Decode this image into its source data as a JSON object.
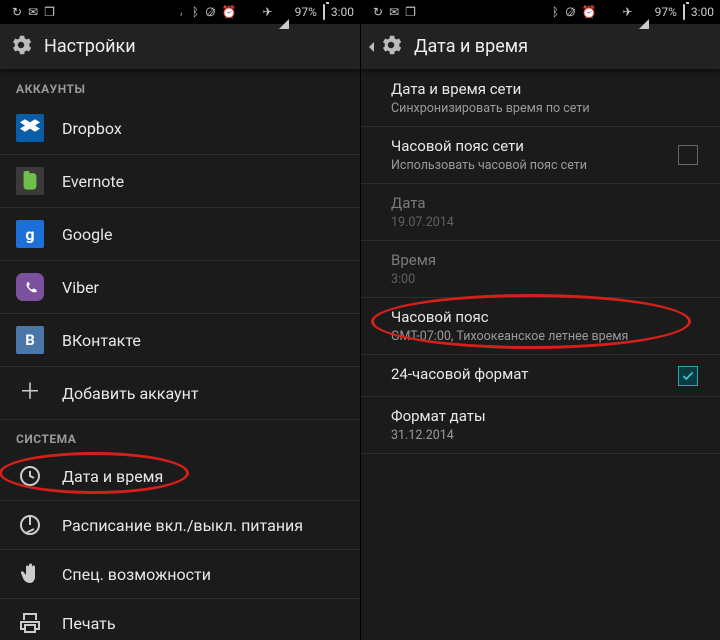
{
  "statusbar": {
    "battery_pct": "97%",
    "time": "3:00"
  },
  "left": {
    "header_title": "Настройки",
    "cat_accounts": "АККАУНТЫ",
    "accounts": [
      {
        "label": "Dropbox"
      },
      {
        "label": "Evernote"
      },
      {
        "label": "Google"
      },
      {
        "label": "Viber"
      },
      {
        "label": "ВКонтакте"
      },
      {
        "label": "Добавить аккаунт"
      }
    ],
    "cat_system": "СИСТЕМА",
    "system": [
      {
        "label": "Дата и время"
      },
      {
        "label": "Расписание вкл./выкл. питания"
      },
      {
        "label": "Спец. возможности"
      },
      {
        "label": "Печать"
      }
    ]
  },
  "right": {
    "header_title": "Дата и время",
    "items": [
      {
        "title": "Дата и время сети",
        "sub": "Синхронизировать время по сети"
      },
      {
        "title": "Часовой пояс сети",
        "sub": "Использовать часовой пояс сети"
      },
      {
        "title": "Дата",
        "sub": "19.07.2014"
      },
      {
        "title": "Время",
        "sub": "3:00"
      },
      {
        "title": "Часовой пояс",
        "sub": "GMT-07:00, Тихоокеанское летнее время"
      },
      {
        "title": "24-часовой формат",
        "sub": ""
      },
      {
        "title": "Формат даты",
        "sub": "31.12.2014"
      }
    ]
  }
}
